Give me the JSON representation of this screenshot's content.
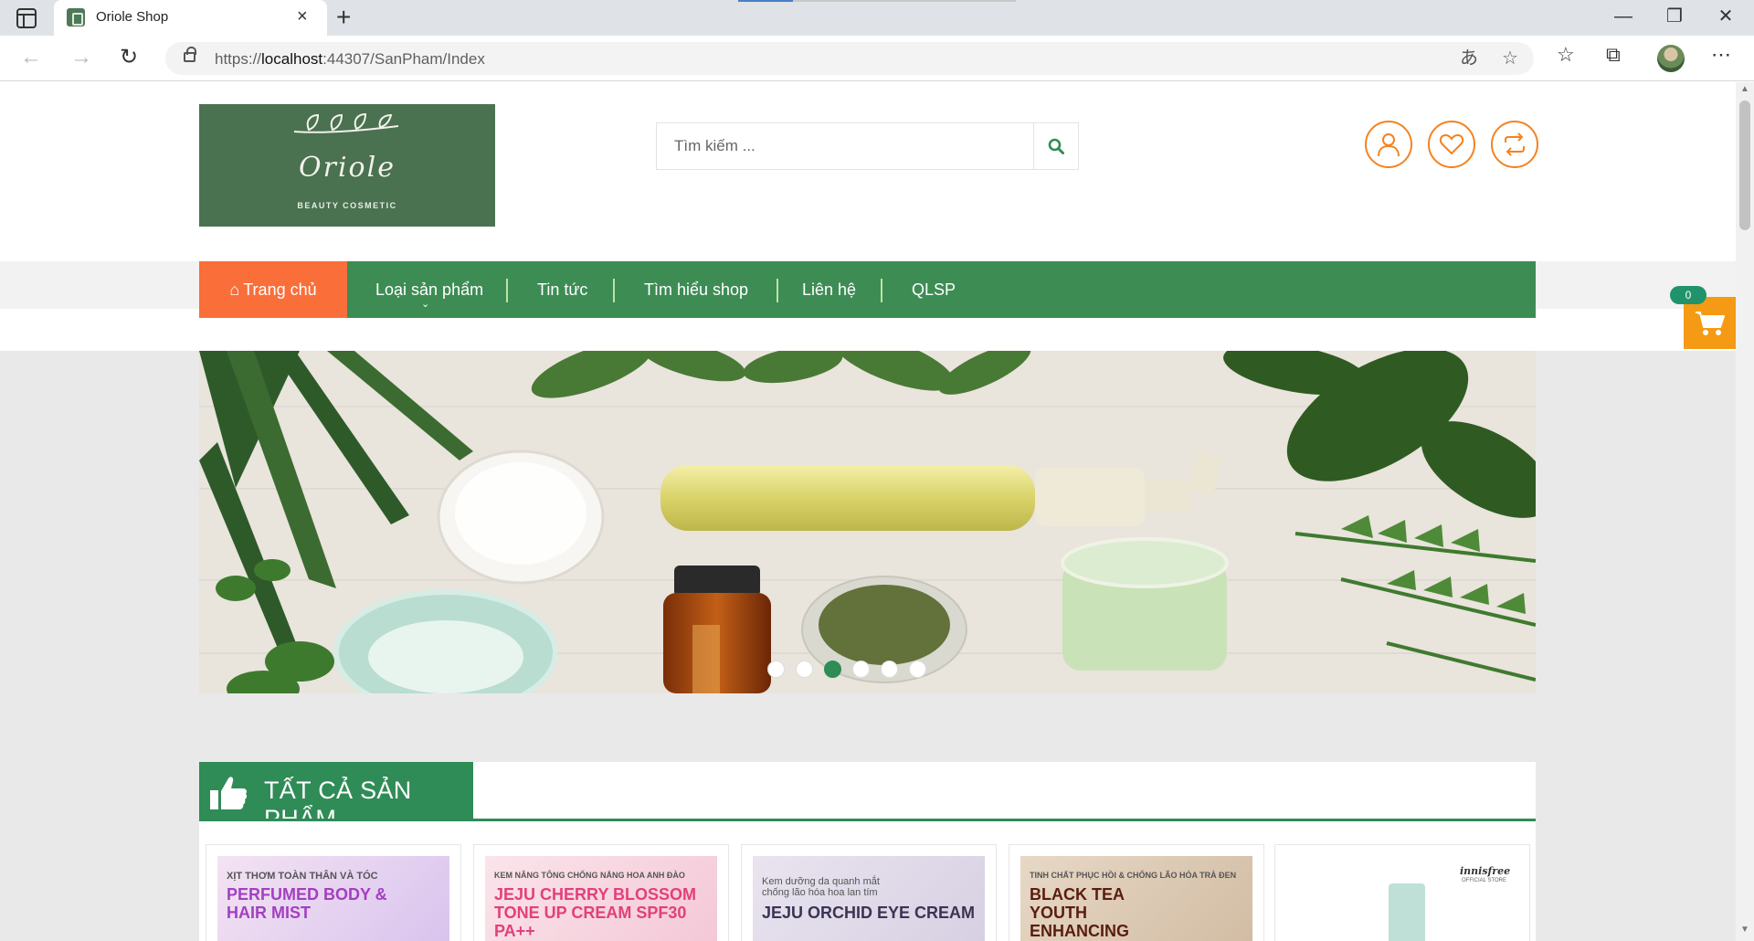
{
  "browser": {
    "tab_title": "Oriole Shop",
    "url_prefix": "https://",
    "url_host": "localhost",
    "url_rest": ":44307/SanPham/Index"
  },
  "site": {
    "logo_name": "Oriole",
    "logo_tagline": "BEAUTY COSMETIC",
    "search_placeholder": "Tìm kiếm ...",
    "cart_count": "0",
    "colors": {
      "brand_green": "#3d8c54",
      "accent_orange": "#fa6e3a",
      "icon_orange": "#f58220",
      "cart_orange": "#f59a14"
    }
  },
  "menu": {
    "home": "Trang chủ",
    "items": [
      "Loại sản phẩm",
      "Tin tức",
      "Tìm hiểu shop",
      "Liên hệ",
      "QLSP"
    ]
  },
  "banner": {
    "slide_count": 6,
    "active_slide": 3
  },
  "section": {
    "title": "TẤT CẢ SẢN PHẨM"
  },
  "products": [
    {
      "small": "XỊT THƠM TOÀN THÂN VÀ TÓC",
      "big": "PERFUMED BODY & HAIR MIST"
    },
    {
      "small": "KEM NÂNG TÔNG CHỐNG NẮNG HOA ANH ĐÀO",
      "big": "JEJU CHERRY BLOSSOM TONE UP CREAM SPF30 PA++"
    },
    {
      "small": "Kem dưỡng da quanh mắt chống lão hóa hoa lan tím",
      "big": "JEJU ORCHID EYE CREAM"
    },
    {
      "small": "TINH CHẤT PHỤC HỒI & CHỐNG LÃO HÓA TRÀ ĐEN",
      "big": "BLACK TEA YOUTH ENHANCING"
    },
    {
      "small": "innisfree",
      "big": "OFFICIAL STORE"
    }
  ]
}
